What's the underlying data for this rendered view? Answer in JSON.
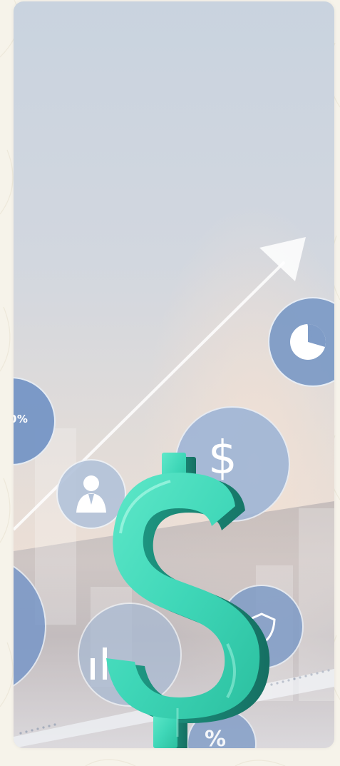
{
  "scene": {
    "background_color": "#f6f3ea",
    "accent_color": "#3fd7b8",
    "circle_color": "#7f9cc7"
  },
  "circles": {
    "left_percent_label": "0%",
    "bottom_percent_label": "%",
    "small_dollar_label": "$"
  }
}
